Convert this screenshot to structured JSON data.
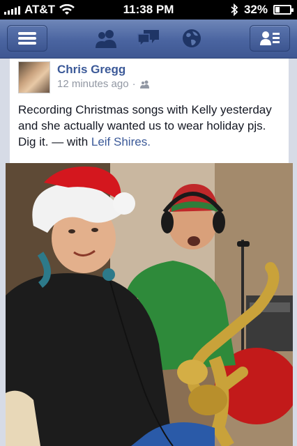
{
  "status_bar": {
    "carrier": "AT&T",
    "time": "11:38 PM",
    "battery": "32%",
    "battery_level": 0.32,
    "icons": [
      "signal-bars-icon",
      "wifi-icon",
      "bluetooth-icon",
      "battery-icon"
    ]
  },
  "nav": {
    "left_icon": "menu-icon",
    "center_icons": [
      "friend-requests-icon",
      "messages-icon",
      "notifications-globe-icon"
    ],
    "right_icon": "contacts-icon"
  },
  "post": {
    "author": "Chris Gregg",
    "time": "12 minutes ago",
    "separator": "·",
    "audience_icon": "friends-icon",
    "text": "Recording Christmas songs with Kelly yesterday and she actually wanted us to wear holiday pjs. Dig it.",
    "with_prefix": " — with ",
    "tagged": "Leif Shires."
  },
  "colors": {
    "nav_blue": "#4a64a0",
    "link_blue": "#3b5998",
    "meta_gray": "#9197a3"
  }
}
